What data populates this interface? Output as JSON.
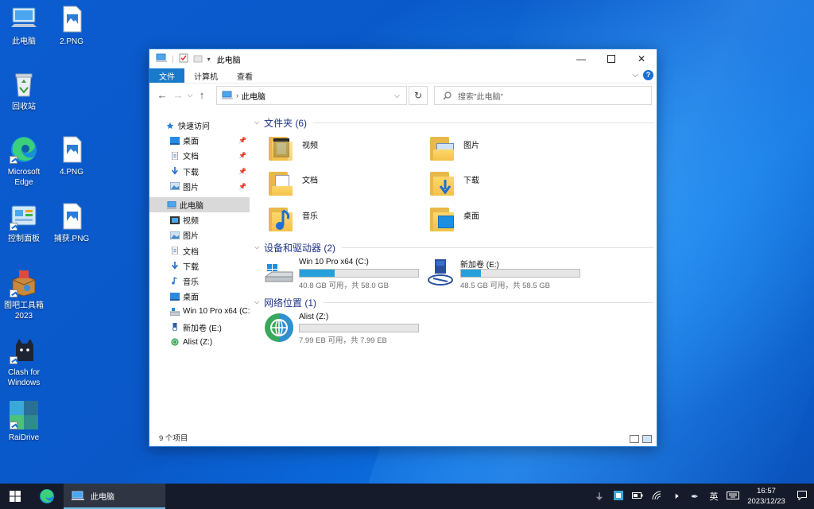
{
  "desktop": {
    "icons": [
      {
        "label": "此电脑",
        "icon": "computer-icon"
      },
      {
        "label": "2.PNG",
        "icon": "image-file-icon"
      },
      {
        "label": "回收站",
        "icon": "recycle-bin-icon"
      },
      {
        "label": "Microsoft Edge",
        "icon": "edge-icon"
      },
      {
        "label": "4.PNG",
        "icon": "image-file-icon"
      },
      {
        "label": "控制面板",
        "icon": "control-panel-icon"
      },
      {
        "label": "捕获.PNG",
        "icon": "image-file-icon"
      },
      {
        "label": "图吧工具箱 2023",
        "icon": "toolbox-icon"
      },
      {
        "label": "Clash for Windows",
        "icon": "cat-icon"
      },
      {
        "label": "RaiDrive",
        "icon": "raidrive-icon"
      }
    ]
  },
  "window": {
    "title": "此电脑",
    "ribbon_tabs": [
      "文件",
      "计算机",
      "查看"
    ],
    "address": {
      "crumb": "此电脑"
    },
    "search": {
      "placeholder": "搜索\"此电脑\""
    },
    "nav_pane": [
      {
        "label": "快速访问",
        "icon": "star-icon",
        "pinned": false
      },
      {
        "label": "桌面",
        "icon": "desktop-icon",
        "pinned": true
      },
      {
        "label": "文档",
        "icon": "document-icon",
        "pinned": true
      },
      {
        "label": "下载",
        "icon": "download-icon",
        "pinned": true
      },
      {
        "label": "图片",
        "icon": "picture-icon",
        "pinned": true
      },
      {
        "label": "此电脑",
        "icon": "computer-icon",
        "selected": true
      },
      {
        "label": "视频",
        "icon": "video-icon"
      },
      {
        "label": "图片",
        "icon": "picture-icon"
      },
      {
        "label": "文档",
        "icon": "document-icon"
      },
      {
        "label": "下载",
        "icon": "download-icon"
      },
      {
        "label": "音乐",
        "icon": "music-icon"
      },
      {
        "label": "桌面",
        "icon": "desktop-icon"
      },
      {
        "label": "Win 10 Pro x64 (C:",
        "icon": "drive-icon"
      },
      {
        "label": "新加卷 (E:)",
        "icon": "drive-icon"
      },
      {
        "label": "Alist (Z:)",
        "icon": "network-drive-icon"
      }
    ],
    "groups": {
      "folders": "文件夹 (6)",
      "devices": "设备和驱动器 (2)",
      "network": "网络位置 (1)"
    },
    "folders": [
      {
        "label": "视频",
        "icon": "video-folder-icon"
      },
      {
        "label": "图片",
        "icon": "picture-folder-icon"
      },
      {
        "label": "文档",
        "icon": "document-folder-icon"
      },
      {
        "label": "下载",
        "icon": "download-folder-icon"
      },
      {
        "label": "音乐",
        "icon": "music-folder-icon"
      },
      {
        "label": "桌面",
        "icon": "desktop-folder-icon"
      }
    ],
    "drives": [
      {
        "name": "Win 10 Pro x64 (C:)",
        "free": "40.8 GB 可用，共 58.0 GB",
        "used_fraction": 0.297,
        "icon": "system-drive-icon"
      },
      {
        "name": "新加卷 (E:)",
        "free": "48.5 GB 可用，共 58.5 GB",
        "used_fraction": 0.171,
        "icon": "usb-drive-icon"
      }
    ],
    "network_drives": [
      {
        "name": "Alist (Z:)",
        "free": "7.99 EB 可用，共 7.99 EB",
        "used_fraction": 0.0,
        "icon": "network-drive-icon"
      }
    ],
    "status": "9 个项目"
  },
  "taskbar": {
    "app_label": "此电脑",
    "ime": "英",
    "time": "16:57",
    "date": "2023/12/23"
  },
  "colors": {
    "accent": "#1979ca",
    "drive_fill": "#26a0da",
    "group_title": "#1e3287",
    "taskbar": "#151b2a"
  }
}
